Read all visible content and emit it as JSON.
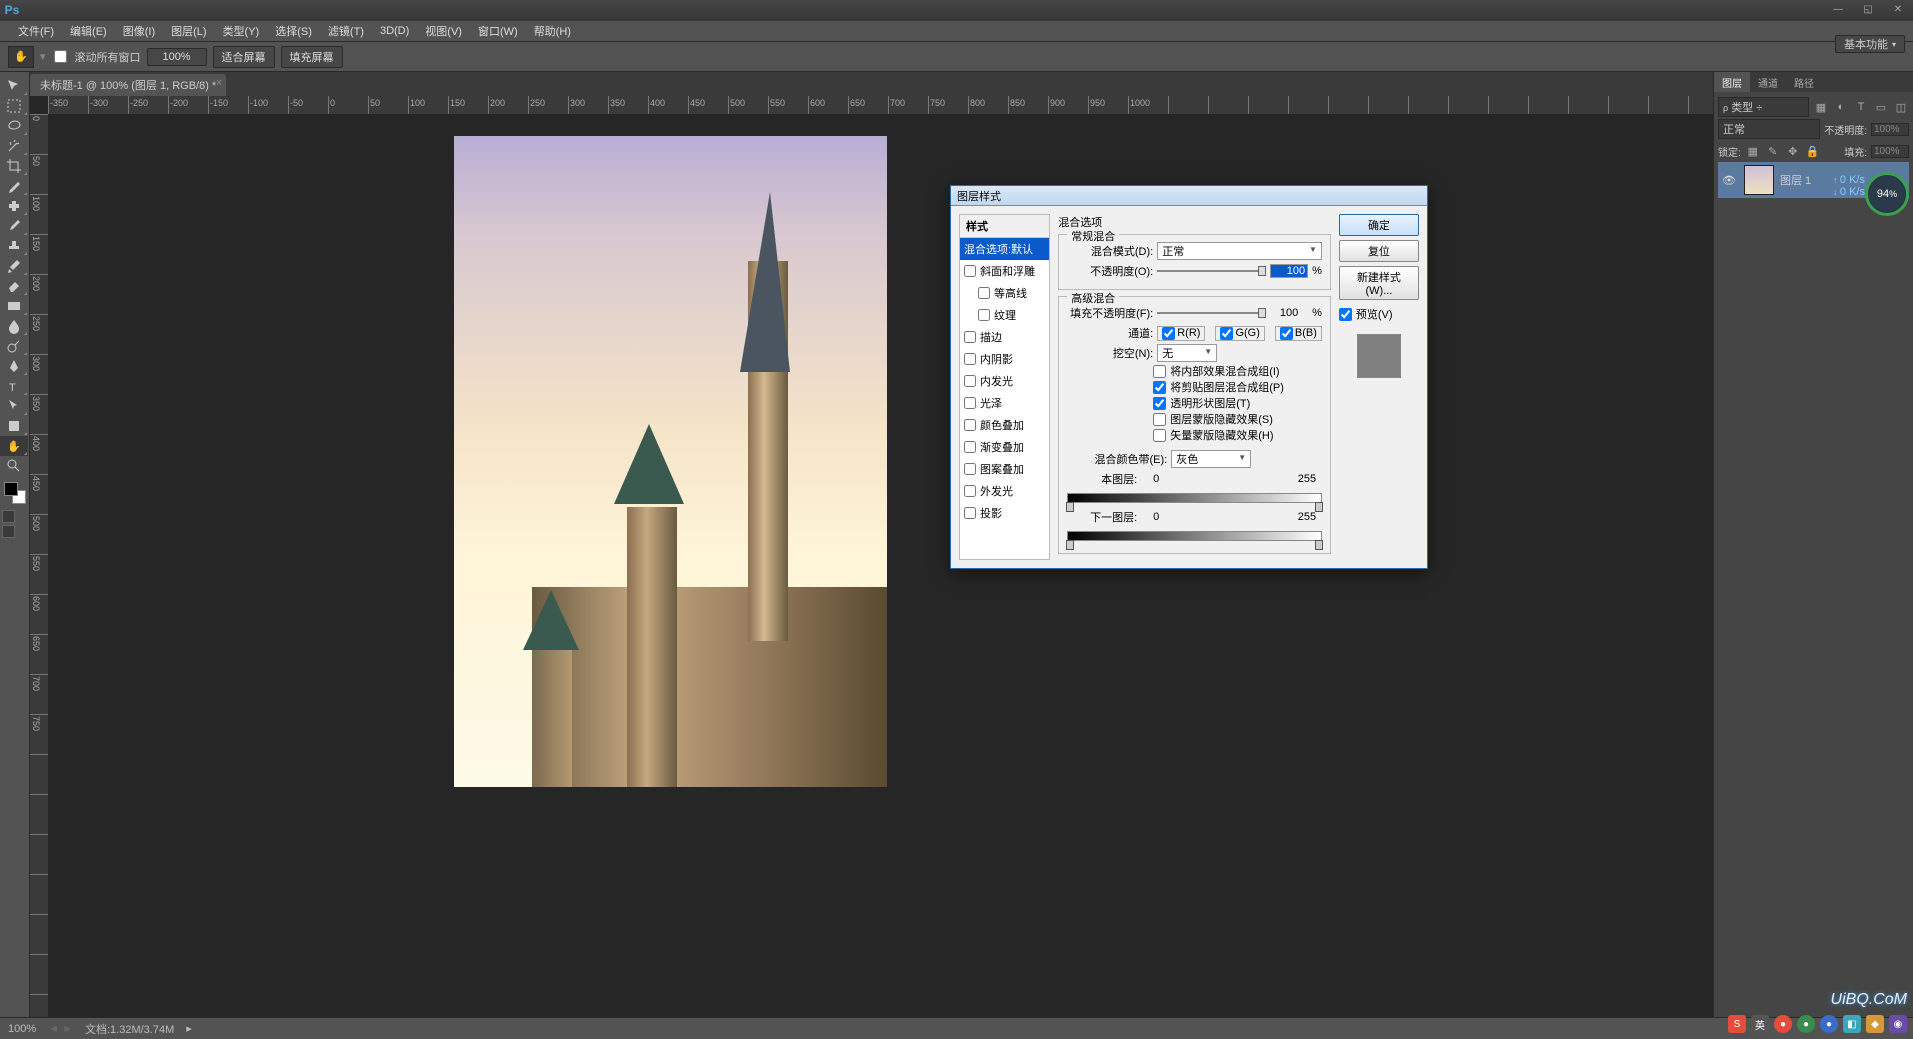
{
  "app": {
    "logo": "Ps"
  },
  "menu": [
    "文件(F)",
    "编辑(E)",
    "图像(I)",
    "图层(L)",
    "类型(Y)",
    "选择(S)",
    "滤镜(T)",
    "3D(D)",
    "视图(V)",
    "窗口(W)",
    "帮助(H)"
  ],
  "options": {
    "scroll_all": "滚动所有窗口",
    "zoom": "100%",
    "fit": "适合屏幕",
    "fill": "填充屏幕",
    "basic": "基本功能"
  },
  "document": {
    "tab": "未标题-1 @ 100% (图层 1, RGB/8) *"
  },
  "ruler_h": [
    "-350",
    "-300",
    "-250",
    "-200",
    "-150",
    "-100",
    "-50",
    "0",
    "50",
    "100",
    "150",
    "200",
    "250",
    "300",
    "350",
    "400",
    "450",
    "500",
    "550",
    "600",
    "650",
    "700",
    "750",
    "800",
    "850",
    "900",
    "950",
    "1000"
  ],
  "ruler_v": [
    "0",
    "50",
    "100",
    "150",
    "200",
    "250",
    "300",
    "350",
    "400",
    "450",
    "500",
    "550",
    "600",
    "650",
    "700",
    "750"
  ],
  "panels": {
    "tabs": [
      "图层",
      "通道",
      "路径"
    ],
    "kind": "类型",
    "blend": "正常",
    "opacity_label": "不透明度:",
    "opacity": "100%",
    "lock_label": "锁定:",
    "fill_label": "填充:",
    "fill": "100%",
    "layer1": "图层 1"
  },
  "dialog": {
    "title": "图层样式",
    "styles_header": "样式",
    "styles": [
      {
        "label": "混合选项:默认",
        "sel": true,
        "cb": false
      },
      {
        "label": "斜面和浮雕",
        "cb": true
      },
      {
        "label": "等高线",
        "cb": true,
        "indent": true
      },
      {
        "label": "纹理",
        "cb": true,
        "indent": true
      },
      {
        "label": "描边",
        "cb": true
      },
      {
        "label": "内阴影",
        "cb": true
      },
      {
        "label": "内发光",
        "cb": true
      },
      {
        "label": "光泽",
        "cb": true
      },
      {
        "label": "颜色叠加",
        "cb": true
      },
      {
        "label": "渐变叠加",
        "cb": true
      },
      {
        "label": "图案叠加",
        "cb": true
      },
      {
        "label": "外发光",
        "cb": true
      },
      {
        "label": "投影",
        "cb": true
      }
    ],
    "section_blend_options": "混合选项",
    "group_general": "常规混合",
    "blend_mode_label": "混合模式(D):",
    "blend_mode": "正常",
    "opacity_label": "不透明度(O):",
    "opacity_value": "100",
    "pct": "%",
    "group_advanced": "高级混合",
    "fill_opacity_label": "填充不透明度(F):",
    "fill_opacity_value": "100",
    "channels_label": "通道:",
    "ch_r": "R(R)",
    "ch_g": "G(G)",
    "ch_b": "B(B)",
    "knockout_label": "挖空(N):",
    "knockout": "无",
    "adv_checks": [
      {
        "label": "将内部效果混合成组(I)",
        "checked": false
      },
      {
        "label": "将剪贴图层混合成组(P)",
        "checked": true
      },
      {
        "label": "透明形状图层(T)",
        "checked": true
      },
      {
        "label": "图层蒙版隐藏效果(S)",
        "checked": false
      },
      {
        "label": "矢量蒙版隐藏效果(H)",
        "checked": false
      }
    ],
    "blend_if_label": "混合颜色带(E):",
    "blend_if": "灰色",
    "this_layer": "本图层:",
    "under_layer": "下一图层:",
    "range_lo": "0",
    "range_hi": "255",
    "btn_ok": "确定",
    "btn_cancel": "复位",
    "btn_newstyle": "新建样式(W)...",
    "preview": "预览(V)"
  },
  "status": {
    "zoom": "100%",
    "docinfo": "文档:1.32M/3.74M"
  },
  "overlay": {
    "perf": "94",
    "perf_unit": "%",
    "net_up": "0 K/s",
    "net_dn": "0 K/s",
    "ime": "英",
    "watermark": "UiBQ.CoM"
  }
}
